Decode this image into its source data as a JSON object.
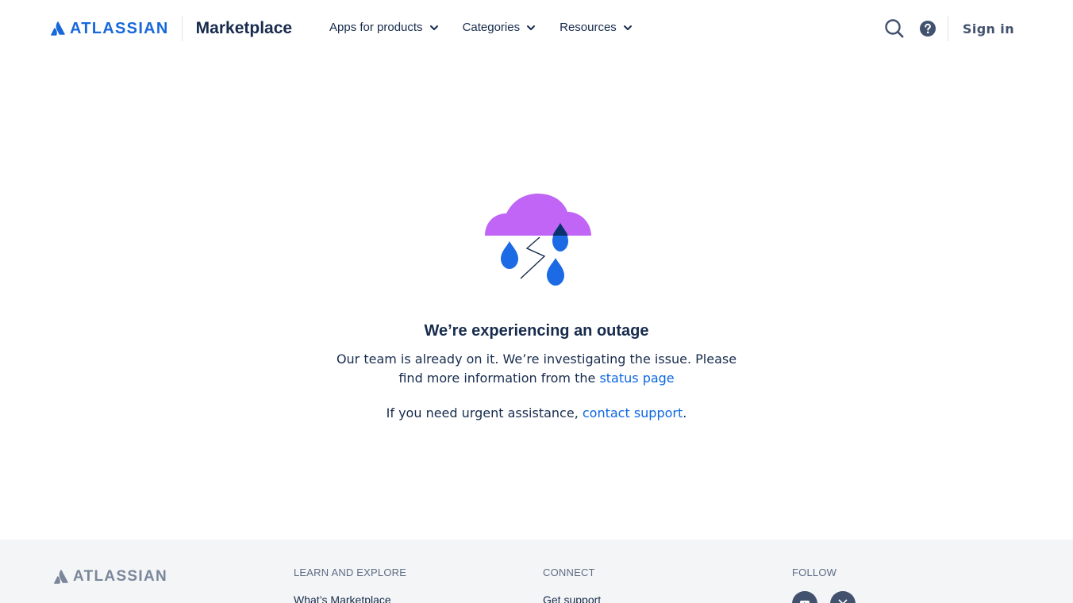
{
  "header": {
    "brand_word": "ATLASSIAN",
    "product": "Marketplace",
    "nav": [
      {
        "label": "Apps for products"
      },
      {
        "label": "Categories"
      },
      {
        "label": "Resources"
      }
    ],
    "search_icon": "search-icon",
    "help_icon": "question-circle-icon",
    "sign_in_label": "Sign in"
  },
  "outage": {
    "illustration": "storm-cloud-icon",
    "title": "We’re experiencing an outage",
    "message_prefix": "Our team is already on it. We’re investigating the issue. Please find more information from the ",
    "status_link": "status page",
    "urgent_prefix": "If you need urgent assistance, ",
    "support_link": "contact support",
    "urgent_suffix": "."
  },
  "footer": {
    "brand_word": "ATLASSIAN",
    "columns": [
      {
        "heading": "LEARN AND EXPLORE",
        "first_link": "What’s Marketplace"
      },
      {
        "heading": "CONNECT",
        "first_link": "Get support"
      },
      {
        "heading": "FOLLOW"
      }
    ],
    "social": [
      "youtube-icon",
      "x-icon"
    ]
  },
  "colors": {
    "brand_blue": "#1868db",
    "link_blue": "#0c66e4",
    "cloud_purple": "#c065f5",
    "drop_blue": "#1d6ae5",
    "text": "#172b4d",
    "footer_bg": "#f4f5f7"
  }
}
